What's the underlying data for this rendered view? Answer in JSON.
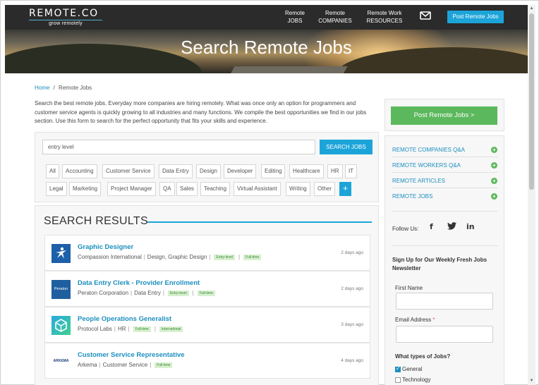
{
  "header": {
    "logo": "REMOTE.CO",
    "tagline": "grow remotely",
    "nav": [
      {
        "line1": "Remote",
        "line2": "JOBS"
      },
      {
        "line1": "Remote",
        "line2": "COMPANIES"
      },
      {
        "line1": "Remote Work",
        "line2": "RESOURCES"
      }
    ],
    "mail_icon": "envelope-icon",
    "post_button": "Post Remote Jobs"
  },
  "hero": {
    "title": "Search Remote Jobs"
  },
  "breadcrumb": {
    "home": "Home",
    "separator": "/",
    "current": "Remote Jobs"
  },
  "intro": "Search the best remote jobs. Everyday more companies are hiring remotely. What was once only an option for programmers and customer service agents is quickly growing to all industries and many functions. We compile the best opportunities we find in our jobs section. Use this form to search for the perfect opportunity that fits your skills and experience.",
  "search": {
    "value": "entry level",
    "button": "SEARCH JOBS"
  },
  "tags": [
    "All",
    "Accounting",
    "Customer Service",
    "Data Entry",
    "Design",
    "Developer",
    "Editing",
    "Healthcare",
    "HR",
    "IT",
    "Legal",
    "Marketing",
    "Project Manager",
    "QA",
    "Sales",
    "Teaching",
    "Virtual Assistant",
    "Writing",
    "Other"
  ],
  "tags_more": "+",
  "results": {
    "title": "SEARCH RESULTS",
    "jobs": [
      {
        "title": "Graphic Designer",
        "company": "Compassion International",
        "category": "Design, Graphic Design",
        "pills": [
          "Entry-level",
          "Full-time"
        ],
        "date": "2 days ago",
        "logo_text": ""
      },
      {
        "title": "Data Entry Clerk - Provider Enrollment",
        "company": "Peraton Corporation",
        "category": "Data Entry",
        "pills": [
          "Entry-level",
          "Full-time"
        ],
        "date": "2 days ago",
        "logo_text": "Peraton"
      },
      {
        "title": "People Operations Generalist",
        "company": "Protocol Labs",
        "category": "HR",
        "pills": [
          "Full-time",
          "International"
        ],
        "date": "3 days ago",
        "logo_text": ""
      },
      {
        "title": "Customer Service Representative",
        "company": "Arkema",
        "category": "Customer Service",
        "pills": [
          "Full-time"
        ],
        "date": "4 days ago",
        "logo_text": "ARKEMA"
      }
    ]
  },
  "sidebar": {
    "post_button": "Post Remote Jobs >",
    "links": [
      "REMOTE COMPANIES Q&A",
      "REMOTE WORKERS Q&A",
      "REMOTE ARTICLES",
      "REMOTE JOBS"
    ],
    "follow_label": "Follow Us:",
    "social": [
      "f",
      "t",
      "in"
    ],
    "newsletter_title": "Sign Up for Our Weekly Fresh Jobs Newsletter",
    "first_name_label": "First Name",
    "email_label": "Email Address",
    "required_mark": "*",
    "job_types_label": "What types of Jobs?",
    "job_types": [
      {
        "label": "General",
        "checked": true
      },
      {
        "label": "Technology",
        "checked": false
      }
    ]
  },
  "colors": {
    "accent": "#1ca4d9",
    "green": "#5cb85c",
    "header_bg": "#2b2b2b",
    "link": "#1c8fbf"
  }
}
